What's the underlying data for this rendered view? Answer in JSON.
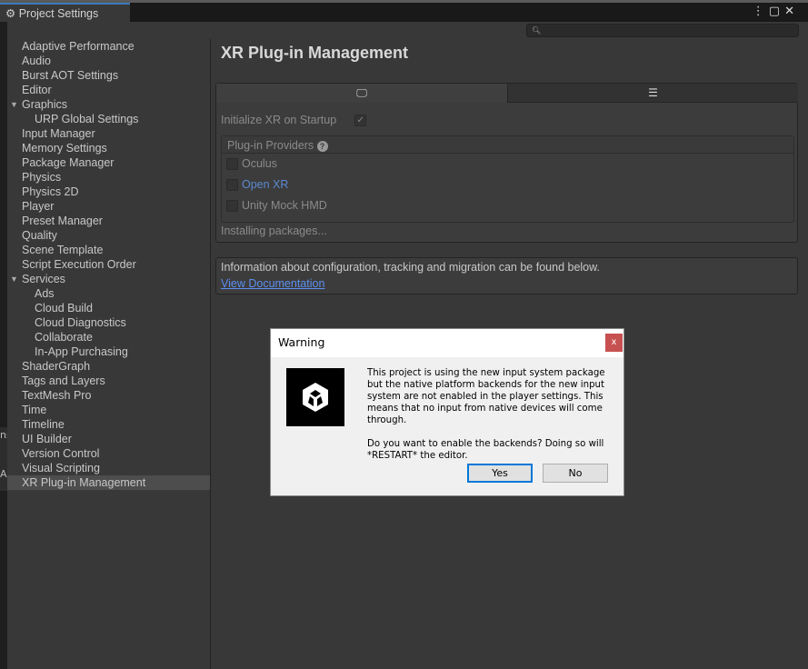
{
  "window": {
    "tab_title": "Project Settings",
    "search_placeholder": ""
  },
  "sidebar": {
    "items": [
      {
        "label": "Adaptive Performance"
      },
      {
        "label": "Audio"
      },
      {
        "label": "Burst AOT Settings"
      },
      {
        "label": "Editor"
      },
      {
        "label": "Graphics",
        "expanded": true
      },
      {
        "label": "URP Global Settings",
        "child": true
      },
      {
        "label": "Input Manager"
      },
      {
        "label": "Memory Settings"
      },
      {
        "label": "Package Manager"
      },
      {
        "label": "Physics"
      },
      {
        "label": "Physics 2D"
      },
      {
        "label": "Player"
      },
      {
        "label": "Preset Manager"
      },
      {
        "label": "Quality"
      },
      {
        "label": "Scene Template"
      },
      {
        "label": "Script Execution Order"
      },
      {
        "label": "Services",
        "expanded": true
      },
      {
        "label": "Ads",
        "child": true
      },
      {
        "label": "Cloud Build",
        "child": true
      },
      {
        "label": "Cloud Diagnostics",
        "child": true
      },
      {
        "label": "Collaborate",
        "child": true
      },
      {
        "label": "In-App Purchasing",
        "child": true
      },
      {
        "label": "ShaderGraph"
      },
      {
        "label": "Tags and Layers"
      },
      {
        "label": "TextMesh Pro"
      },
      {
        "label": "Time"
      },
      {
        "label": "Timeline"
      },
      {
        "label": "UI Builder"
      },
      {
        "label": "Version Control"
      },
      {
        "label": "Visual Scripting"
      },
      {
        "label": "XR Plug-in Management",
        "selected": true
      }
    ]
  },
  "main": {
    "title": "XR Plug-in Management",
    "tabs": [
      {
        "icon": "desktop-icon",
        "active": true
      },
      {
        "icon": "server-icon",
        "active": false
      }
    ],
    "init_label": "Initialize XR on Startup",
    "init_checked": true,
    "providers_header": "Plug-in Providers",
    "providers": [
      {
        "label": "Oculus",
        "checked": false
      },
      {
        "label": "Open XR",
        "checked": false
      },
      {
        "label": "Unity Mock HMD",
        "checked": false
      }
    ],
    "installing": "Installing packages...",
    "info_text": "Information about configuration, tracking and migration can be found below.",
    "doc_link": "View Documentation"
  },
  "dialog": {
    "title": "Warning",
    "close": "x",
    "message1": "This project is using the new input system package but the native platform backends for the new input system are not enabled in the player settings. This means that no input from native devices will come through.",
    "message2": "Do you want to enable the backends? Doing so will *RESTART* the editor.",
    "yes": "Yes",
    "no": "No"
  },
  "edge": {
    "left_text_1": "ns",
    "left_text_2": "A"
  }
}
